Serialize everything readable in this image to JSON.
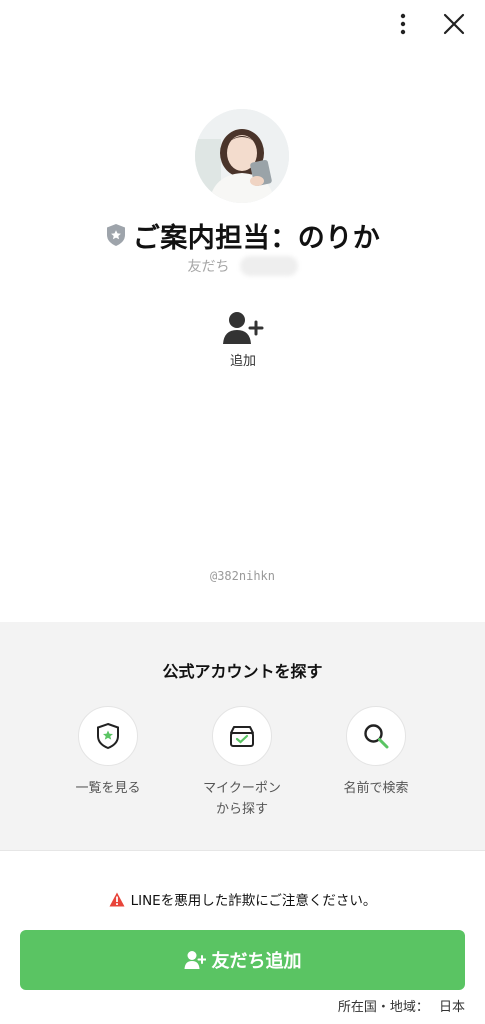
{
  "profile": {
    "name": "ご案内担当：のりか",
    "friends_label": "友だち",
    "user_id": "@382nihkn"
  },
  "actions": {
    "add_label": "追加"
  },
  "find_accounts": {
    "title": "公式アカウントを探す",
    "items": [
      {
        "label": "一覧を見る",
        "icon": "shield-star-icon"
      },
      {
        "label": "マイクーポン\nから探す",
        "icon": "coupon-icon"
      },
      {
        "label": "名前で検索",
        "icon": "search-icon"
      }
    ]
  },
  "footer": {
    "warning": "LINEを悪用した詐欺にご注意ください。",
    "add_friend_button": "友だち追加",
    "region_label": "所在国・地域：",
    "region_value": "日本"
  },
  "colors": {
    "accent_green": "#5ac463",
    "warning_red": "#e8443a",
    "section_bg": "#f3f3f3"
  }
}
